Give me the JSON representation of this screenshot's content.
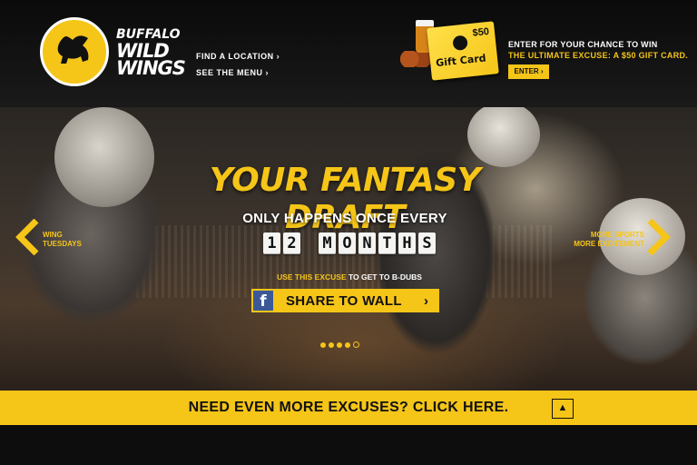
{
  "brand": {
    "line1": "Buffalo",
    "line2": "Wild",
    "line3": "Wings"
  },
  "nav": {
    "find_location": "Find a Location",
    "see_menu": "See the Menu"
  },
  "promo": {
    "gift_amount": "$50",
    "gift_label": "Gift Card",
    "line1": "Enter for your chance to win",
    "line2": "The Ultimate Excuse: A $50 Gift Card.",
    "enter_label": "Enter"
  },
  "hero": {
    "headline": "Your Fantasy Draft",
    "subhead": "Only happens once every",
    "flip_chars": [
      "1",
      "2",
      " ",
      "M",
      "O",
      "N",
      "T",
      "H",
      "S"
    ],
    "excuse_highlight": "Use this excuse",
    "excuse_rest": " to get to B-Dubs",
    "share_label": "Share to Wall",
    "prev_label_1": "Wing",
    "prev_label_2": "Tuesdays",
    "next_label_1": "More Sports",
    "next_label_2": "More Excitement"
  },
  "carousel": {
    "total": 5,
    "active_index": 4
  },
  "footer": {
    "cta": "Need even more excuses? Click here."
  },
  "colors": {
    "accent": "#f5c518",
    "background": "#0d0d0d",
    "facebook": "#3b5998"
  },
  "icons": {
    "logo": "buffalo-icon",
    "nav_chevron": "chevron-right-icon",
    "prev": "arrow-left-icon",
    "next": "arrow-right-icon",
    "share": "facebook-icon",
    "up": "caret-up-icon"
  }
}
